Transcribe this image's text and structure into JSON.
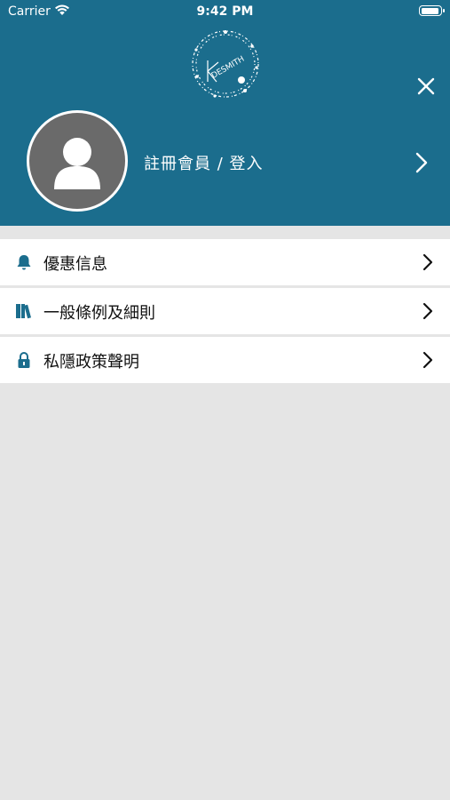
{
  "status_bar": {
    "carrier": "Carrier",
    "time": "9:42 PM"
  },
  "header": {
    "logo_text": "DESMITH",
    "login_label": "註冊會員 / 登入",
    "background_color": "#1b6d8d"
  },
  "menu": {
    "items": [
      {
        "label": "優惠信息",
        "icon": "bell-icon"
      },
      {
        "label": "一般條例及細則",
        "icon": "books-icon"
      },
      {
        "label": "私隱政策聲明",
        "icon": "lock-icon"
      }
    ]
  },
  "colors": {
    "accent": "#1b6d8d",
    "background": "#e5e5e5"
  }
}
